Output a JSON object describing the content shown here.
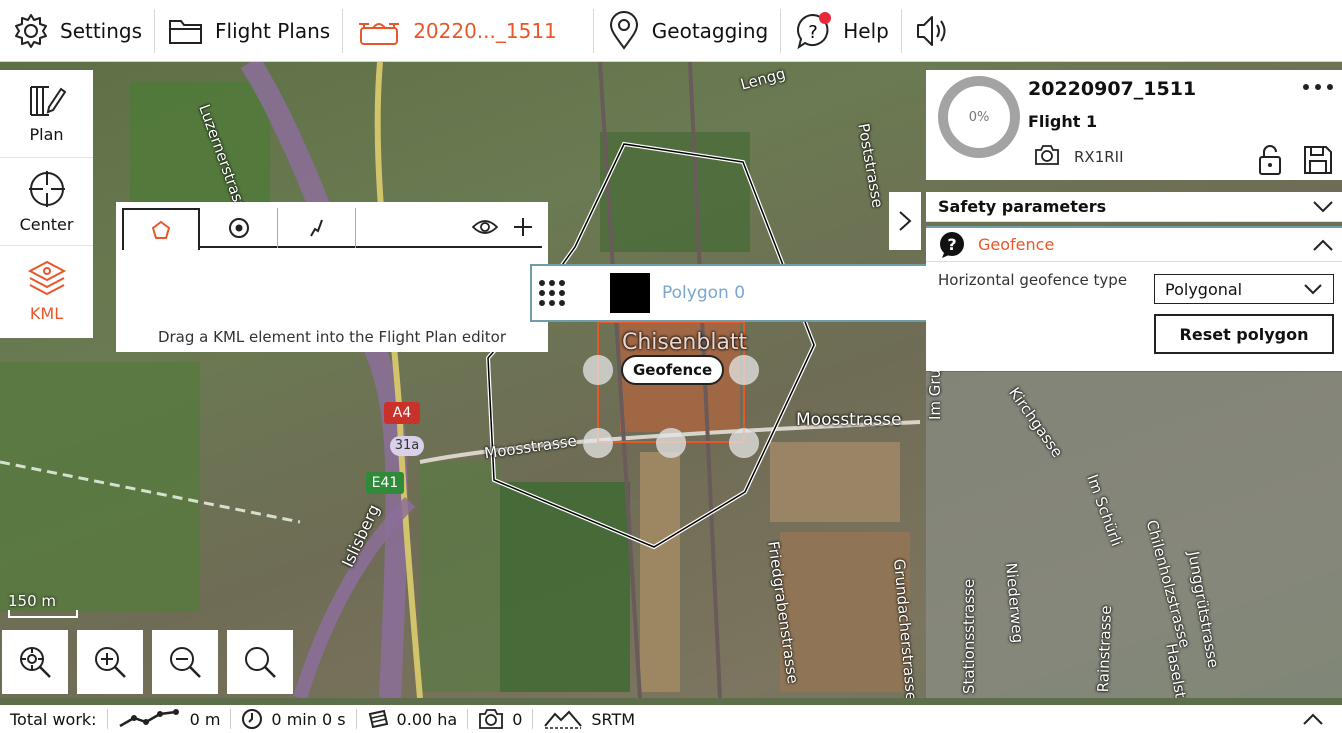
{
  "topbar": {
    "settings": "Settings",
    "flight_plans": "Flight Plans",
    "current_plan": "20220..._1511",
    "geotagging": "Geotagging",
    "help": "Help"
  },
  "left_tools": {
    "plan": "Plan",
    "center": "Center",
    "kml": "KML"
  },
  "kml_panel": {
    "hint": "Drag a KML element into the Flight Plan editor",
    "item_name": "Polygon 0"
  },
  "map": {
    "geofence_label": "Geofence",
    "scale": "150 m",
    "streets": [
      "Luzernerstrasse",
      "Lengg",
      "Poststrasse",
      "Chisenblatt",
      "Moosstrasse",
      "Moosstrasse",
      "Im Grundacher",
      "Friedgrabenstrasse",
      "Grundacherstrasse",
      "Islisberg",
      "Kirchgasse",
      "Im Schürli",
      "Chilenholzstrasse",
      "Junggrütstrasse",
      "Niederweg",
      "Stationsstrasse",
      "Rainstrasse",
      "Haselstrasse"
    ],
    "road_signs": [
      "A4",
      "31a",
      "E41"
    ]
  },
  "right_panel": {
    "progress": "0%",
    "title": "20220907_1511",
    "flight": "Flight 1",
    "camera": "RX1RII",
    "safety_parameters": "Safety parameters",
    "geofence_title": "Geofence",
    "horizontal_label": "Horizontal geofence type",
    "geofence_type": "Polygonal",
    "reset_button": "Reset polygon"
  },
  "bottom_bar": {
    "total_work": "Total work:",
    "distance": "0 m",
    "time": "0 min 0 s",
    "area": "0.00 ha",
    "photos": "0",
    "elevation": "SRTM"
  },
  "colors": {
    "accent": "#e8572a",
    "panel_border": "#6f9ea8"
  }
}
